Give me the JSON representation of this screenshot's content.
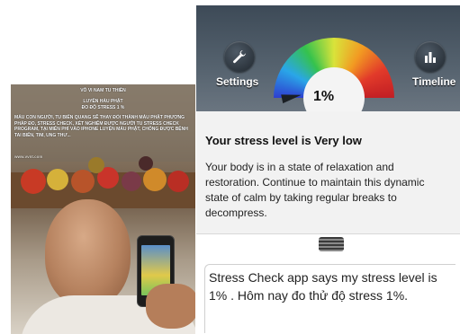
{
  "photo": {
    "title": "VÔ VI NAM TU THIỀN",
    "subtitle1": "LUYỆN HÀU PHẬT",
    "subtitle2": "ĐO ĐỘ STRESS 1 %",
    "body": "MÁU CON NGƯỜI, TU BIẾN QUANG SẼ THAY ĐỔI THÀNH MÁU PHẬT PHƯƠNG PHÁP ĐO, STRESS CHECK, XÉT NGHIỆM ĐƯỢC NGƯỜI TU STRESS CHECK PROGRAM, TẠI MIỄN PHÍ VÀO IPHONE LUYỆN MÁU PHẬT, CHỐNG ĐƯỢC BỆNH TAI BIẾN, TIM, UNG THƯ...",
    "site": "www.vvnt.com"
  },
  "app": {
    "settings_label": "Settings",
    "timeline_label": "Timeline",
    "stress_percent": "1%",
    "gauge_level": 0.01,
    "result_title": "Your stress level is Very low",
    "result_body": "Your body is in a state of relaxation and restoration. Continue to maintain this dynamic state of calm by taking regular breaks to decompress.",
    "icons": {
      "settings": "wrench-icon",
      "timeline": "bar-chart-icon",
      "drag": "drag-handle-icon"
    }
  },
  "caption": {
    "text": "Stress Check app says my stress level is 1% . Hôm nay đo thử độ stress 1%."
  },
  "colors": {
    "top_bar": "#3d4a57",
    "card": "#f2f2f2",
    "gauge_low": "#2e3fd0",
    "gauge_high": "#c21f24"
  }
}
